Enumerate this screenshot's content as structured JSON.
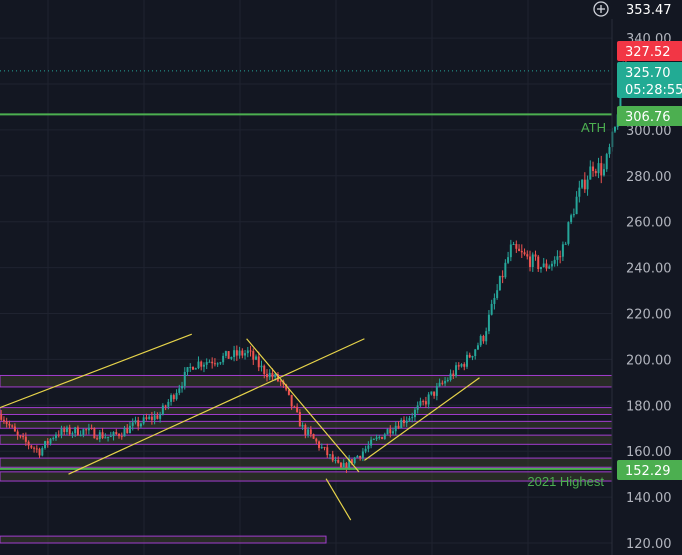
{
  "colors": {
    "background": "#131722",
    "grid": "#1f2330",
    "axis_text": "#b2b5be",
    "up": "#26a69a",
    "down": "#ef5350",
    "trendline": "#e6d34a",
    "zone_border": "#a23ccf",
    "zone_fill": "#3a3c2a",
    "level_line": "#4caf50"
  },
  "header": {
    "crosshair_icon": "plus-circle-icon",
    "crosshair_price": "353.47"
  },
  "price_tags": [
    {
      "name": "previous-close",
      "lines": [
        "327.52"
      ],
      "color": "#f23645"
    },
    {
      "name": "last-price",
      "lines": [
        "325.70",
        "05:28:55"
      ],
      "color": "#22ab94"
    },
    {
      "name": "ath-level",
      "lines": [
        "306.76"
      ],
      "color": "#4caf50"
    },
    {
      "name": "highest-2021-level",
      "lines": [
        "152.29"
      ],
      "color": "#4caf50"
    }
  ],
  "annotations": {
    "ath_label": "ATH",
    "highest_2021_label": "2021 Highest"
  },
  "chart_data": {
    "type": "candlestick",
    "y_ticks": [
      120,
      140,
      160,
      180,
      200,
      220,
      240,
      260,
      280,
      300,
      320,
      340
    ],
    "y_tick_labels": [
      "120.00",
      "140.00",
      "160.00",
      "180.00",
      "200.00",
      "220.00",
      "240.00",
      "260.00",
      "280.00",
      "300.00",
      "",
      "340.00"
    ],
    "ylim": [
      118,
      361
    ],
    "candle_count": 205,
    "horizontal_levels": [
      {
        "price": 306.76,
        "label": "ATH"
      },
      {
        "price": 152.29,
        "label": "2021 Highest"
      }
    ],
    "last_price": 325.7,
    "previous_close": 327.52,
    "crosshair_price": 353.47,
    "price_path": [
      [
        0,
        176
      ],
      [
        6,
        166
      ],
      [
        14,
        160
      ],
      [
        20,
        168
      ],
      [
        30,
        169
      ],
      [
        40,
        166
      ],
      [
        50,
        172
      ],
      [
        58,
        176
      ],
      [
        63,
        185
      ],
      [
        70,
        198
      ],
      [
        78,
        200
      ],
      [
        90,
        203
      ],
      [
        95,
        196
      ],
      [
        102,
        190
      ],
      [
        110,
        170
      ],
      [
        118,
        160
      ],
      [
        124,
        152
      ],
      [
        130,
        158
      ],
      [
        136,
        164
      ],
      [
        142,
        170
      ],
      [
        150,
        176
      ],
      [
        160,
        188
      ],
      [
        170,
        200
      ],
      [
        176,
        210
      ],
      [
        180,
        226
      ],
      [
        186,
        248
      ],
      [
        192,
        244
      ],
      [
        198,
        240
      ],
      [
        204,
        245
      ],
      [
        210,
        270
      ],
      [
        216,
        285
      ],
      [
        220,
        282
      ],
      [
        224,
        300
      ],
      [
        227,
        328
      ],
      [
        228,
        326
      ]
    ],
    "trend_lines": [
      {
        "from": [
          0,
          179
        ],
        "to": [
          70,
          211
        ]
      },
      {
        "from": [
          25,
          150
        ],
        "to": [
          133,
          209
        ]
      },
      {
        "from": [
          90,
          209
        ],
        "to": [
          131,
          151
        ]
      },
      {
        "from": [
          119,
          148
        ],
        "to": [
          128,
          130
        ]
      },
      {
        "from": [
          133,
          156
        ],
        "to": [
          175,
          192
        ]
      }
    ],
    "zones": [
      {
        "from": 188,
        "to": 193
      },
      {
        "from": 176,
        "to": 179
      },
      {
        "from": 170,
        "to": 173
      },
      {
        "from": 163,
        "to": 167
      },
      {
        "from": 153,
        "to": 157
      },
      {
        "from": 147,
        "to": 151
      },
      {
        "from": 120,
        "to": 123
      }
    ]
  }
}
